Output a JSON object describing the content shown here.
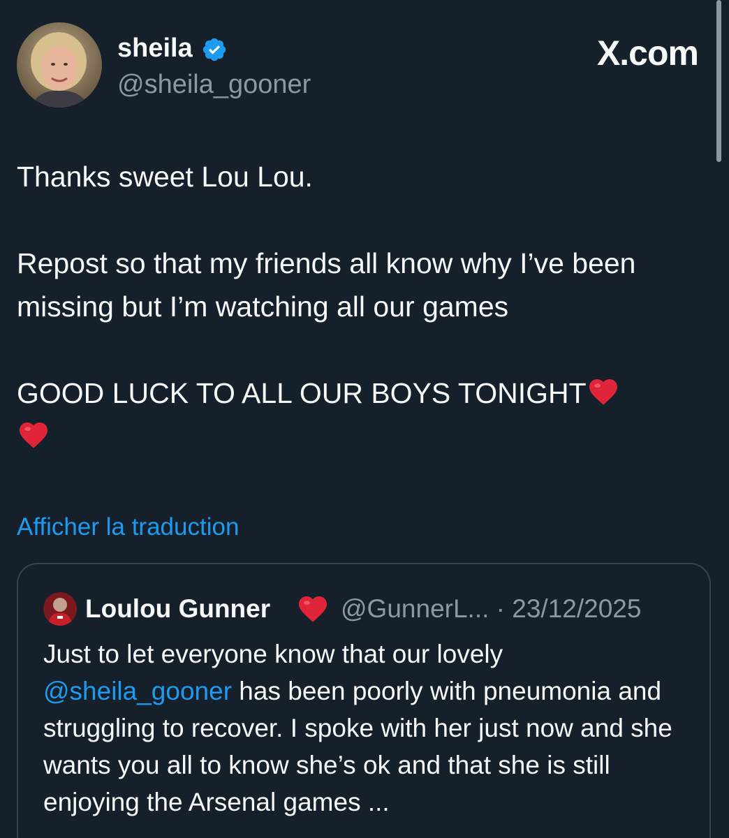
{
  "header": {
    "display_name": "sheila",
    "handle": "@sheila_gooner",
    "brand": "X.com"
  },
  "tweet": {
    "line1": "Thanks sweet Lou Lou.",
    "line2": "Repost so that my friends all know why I’ve been missing but I’m watching all our games",
    "line3": "GOOD LUCK TO ALL OUR BOYS TONIGHT",
    "translate_label": "Afficher la traduction"
  },
  "quote": {
    "display_name": "Loulou Gunner",
    "handle": "@GunnerL...",
    "separator": "·",
    "date": "23/12/2025",
    "text_before": "Just to let everyone know that our lovely ",
    "mention": "@sheila_gooner",
    "text_after": " has been poorly with pneumonia and struggling to recover. I spoke with her just now and she wants you all to know she’s ok and that she is still enjoying the Arsenal games ..."
  },
  "icons": {
    "verified": "verified-badge-icon",
    "heart": "red-heart-icon"
  },
  "colors": {
    "background": "#15202b",
    "text": "#f7f9f9",
    "muted": "#8b98a5",
    "link": "#1d9bf0",
    "heart": "#e0243a",
    "border": "#38444d"
  }
}
